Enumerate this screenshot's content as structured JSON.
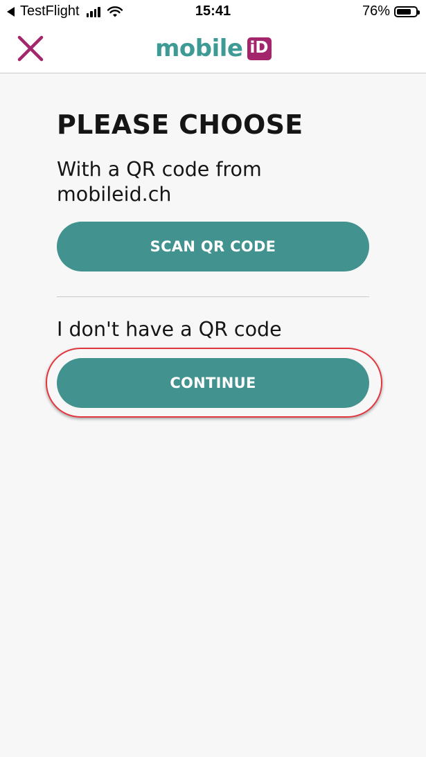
{
  "status_bar": {
    "back_app": "TestFlight",
    "time": "15:41",
    "battery_percent_label": "76%",
    "battery_level": 0.76
  },
  "nav": {
    "logo_text": "mobile",
    "logo_badge": "iD"
  },
  "main": {
    "title": "PLEASE CHOOSE",
    "option_qr_text": "With a QR code from mobileid.ch",
    "scan_button_label": "SCAN QR CODE",
    "option_no_qr_text": "I don't have a QR code",
    "continue_button_label": "CONTINUE"
  },
  "colors": {
    "accent": "#42928f",
    "brand_magenta": "#a3256b",
    "highlight": "#e2363f",
    "background": "#f7f7f7"
  },
  "icons": {
    "close": "close-icon",
    "back": "back-arrow-icon",
    "signal": "cellular-signal-icon",
    "wifi": "wifi-icon",
    "battery": "battery-icon"
  }
}
